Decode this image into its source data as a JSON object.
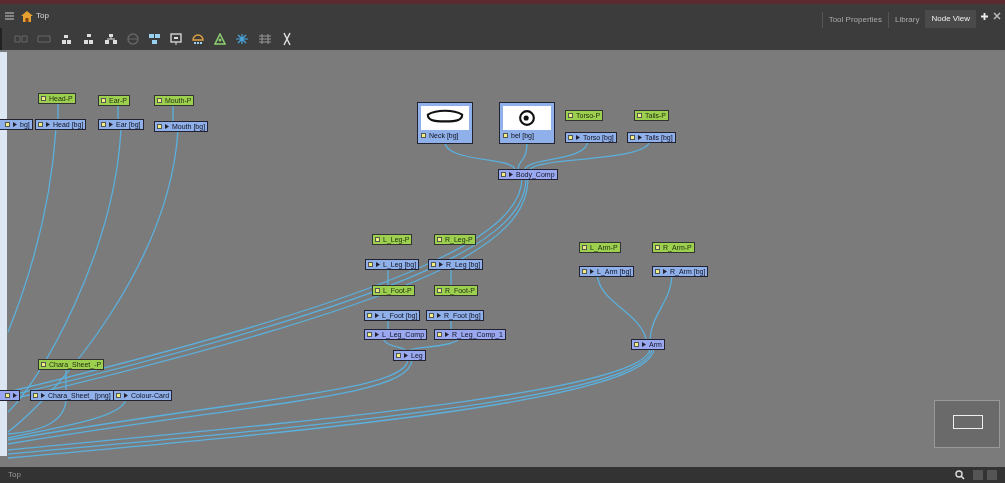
{
  "breadcrumb": "Top",
  "tabs": [
    {
      "label": "Tool Properties",
      "selected": false
    },
    {
      "label": "Library",
      "selected": false
    },
    {
      "label": "Node View",
      "selected": true
    }
  ],
  "nodes": [
    {
      "kind": "peg",
      "label": "Head-P"
    },
    {
      "kind": "peg",
      "label": "Ear-P"
    },
    {
      "kind": "peg",
      "label": "Mouth-P"
    },
    {
      "kind": "drawing",
      "label": "bg]"
    },
    {
      "kind": "drawing",
      "label": "Head [bg]"
    },
    {
      "kind": "drawing",
      "label": "Ear [bg]"
    },
    {
      "kind": "drawing",
      "label": "Mouth [bg]"
    },
    {
      "kind": "thumbnail",
      "label": "Neck [bg]"
    },
    {
      "kind": "thumbnail",
      "label": "bel [bg]"
    },
    {
      "kind": "peg",
      "label": "Torso-P"
    },
    {
      "kind": "peg",
      "label": "Tails-P"
    },
    {
      "kind": "drawing",
      "label": "Torso [bg]"
    },
    {
      "kind": "drawing",
      "label": "Tails [bg]"
    },
    {
      "kind": "composite",
      "label": "Body_Comp"
    },
    {
      "kind": "peg",
      "label": "L_Leg-P"
    },
    {
      "kind": "peg",
      "label": "R_Leg-P"
    },
    {
      "kind": "drawing",
      "label": "L_Leg [bg]"
    },
    {
      "kind": "drawing",
      "label": "R_Leg [bg]"
    },
    {
      "kind": "peg",
      "label": "L_Foot-P"
    },
    {
      "kind": "peg",
      "label": "R_Foot-P"
    },
    {
      "kind": "drawing",
      "label": "L_Foot [bg]"
    },
    {
      "kind": "drawing",
      "label": "R_Foot [bg]"
    },
    {
      "kind": "composite",
      "label": "L_Leg_Comp"
    },
    {
      "kind": "composite",
      "label": "R_Leg_Comp_1"
    },
    {
      "kind": "composite",
      "label": "Leg"
    },
    {
      "kind": "peg",
      "label": "L_Arm-P"
    },
    {
      "kind": "peg",
      "label": "R_Arm-P"
    },
    {
      "kind": "drawing",
      "label": "L_Arm [bg]"
    },
    {
      "kind": "drawing",
      "label": "R_Arm [bg]"
    },
    {
      "kind": "composite",
      "label": "Arm"
    },
    {
      "kind": "peg",
      "label": "Chara_Sheet_-P"
    },
    {
      "kind": "composite"
    },
    {
      "kind": "drawing",
      "label": "Chara_Sheet_ [png]"
    },
    {
      "kind": "drawing",
      "label": "Colour-Card"
    }
  ],
  "status_bar": "Top"
}
